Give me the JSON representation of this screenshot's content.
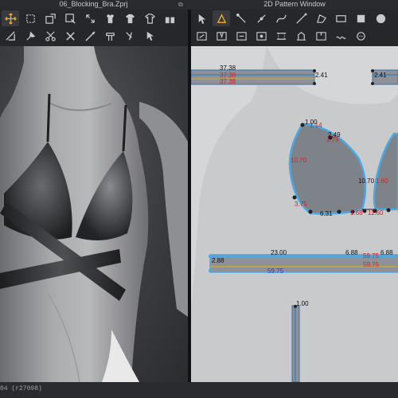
{
  "window": {
    "left_title": "06_Blocking_Bra.Zprj",
    "right_title": "2D Pattern Window"
  },
  "toolbar_left": {
    "row1": [
      "move-tool-icon",
      "select-rect-icon",
      "transform-icon",
      "edit-pattern-icon",
      "garment-icon",
      "avatar-icon",
      "tshirt-icon",
      "tshirt-alt-icon",
      "gift-icon"
    ],
    "row2": [
      "fold-icon",
      "pin-icon",
      "scissors-icon",
      "tack-icon",
      "needle-icon",
      "sewing-icon",
      "tape-icon",
      "select-all-icon"
    ]
  },
  "toolbar_right": {
    "row1": [
      "select-move-icon",
      "transform-pattern-icon",
      "edit-point-icon",
      "add-point-icon",
      "curve-icon",
      "line-icon",
      "polygon-icon",
      "rectangle-icon",
      "square-icon",
      "circle-icon"
    ],
    "row2": [
      "internal-line-icon",
      "dart-icon",
      "trace-icon",
      "offset-icon",
      "seam-icon",
      "fold-arrange-icon",
      "notch-icon",
      "gathering-icon",
      "button-icon"
    ]
  },
  "pattern_labels": {
    "top_strip_a": "37.38",
    "top_strip_b": "37.38",
    "top_strip_c": "37.38",
    "top_strip_right": "2.41",
    "top_strip_far": "2.41",
    "cup_top": "1.00",
    "cup_top_red": "1.14",
    "cup_mid_black": "2.49",
    "cup_mid_red": "1.79",
    "cup_left": "10.70",
    "cup_center": "10.70",
    "cup_center_red": "1.60",
    "cup_bottom_left": "3.75",
    "cup_bottom_a": "6.31",
    "cup_bottom_b": "1.68",
    "cup_bottom_c": "11.60",
    "band_left": "2.88",
    "band_mid": "23.00",
    "band_right_a": "6.88",
    "band_right_red": "59.75",
    "band_right_b": "6.88",
    "band_bottom": "59.75",
    "band_bottom_right": "59.75",
    "strap_top": "1.00"
  },
  "status": {
    "text": "04    (r27098)"
  }
}
